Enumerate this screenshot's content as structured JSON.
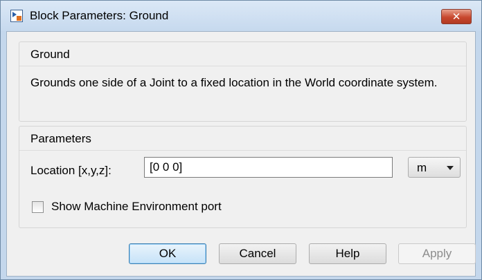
{
  "window": {
    "title": "Block Parameters: Ground",
    "close_label": "✕"
  },
  "group_ground": {
    "legend": "Ground",
    "description": "Grounds one side of a Joint to a fixed location in the World coordinate system."
  },
  "group_parameters": {
    "legend": "Parameters",
    "location_label": "Location [x,y,z]:",
    "location_value": "[0 0 0]",
    "unit_value": "m",
    "checkbox_label": "Show Machine Environment port",
    "checkbox_checked": false
  },
  "buttons": {
    "ok": "OK",
    "cancel": "Cancel",
    "help": "Help",
    "apply": "Apply"
  }
}
